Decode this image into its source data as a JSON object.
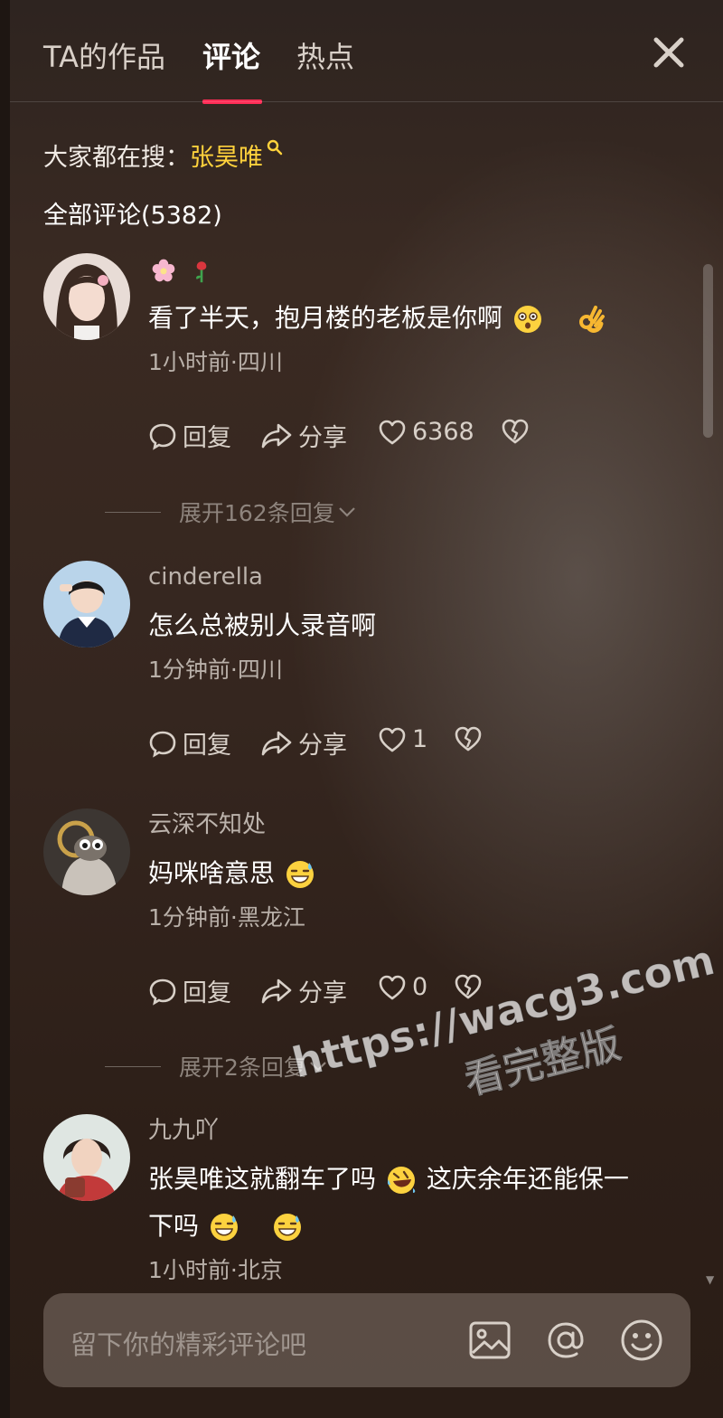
{
  "tabs": [
    {
      "label": "TA的作品",
      "active": false
    },
    {
      "label": "评论",
      "active": true
    },
    {
      "label": "热点",
      "active": false
    }
  ],
  "hot_search": {
    "prefix": "大家都在搜：",
    "term": "张昊唯"
  },
  "comments_header": "全部评论(5382)",
  "actions": {
    "reply": "回复",
    "share": "分享"
  },
  "comments": [
    {
      "username": "",
      "username_emojis": [
        "flower-emoji",
        "rose-emoji"
      ],
      "text": "看了半天，抱月楼的老板是你啊",
      "text_emojis": [
        "astonished-face-emoji",
        "ok-hand-emoji"
      ],
      "meta": "1小时前·四川",
      "likes": "6368",
      "expand": "展开162条回复"
    },
    {
      "username": "cinderella",
      "text": "怎么总被别人录音啊",
      "meta": "1分钟前·四川",
      "likes": "1",
      "expand": ""
    },
    {
      "username": "云深不知处",
      "text": "妈咪啥意思",
      "text_emojis": [
        "grinning-sweat-emoji"
      ],
      "meta": "1分钟前·黑龙江",
      "likes": "0",
      "expand": "展开2条回复"
    },
    {
      "username": "九九吖",
      "text_part1": "张昊唯这就翻车了吗",
      "text_part2": "这庆余年还能保一",
      "text_part3": "下吗",
      "text_emojis": [
        "rolling-laugh-emoji",
        "grinning-sweat-emoji",
        "grinning-sweat-emoji"
      ],
      "meta": "1小时前·北京"
    }
  ],
  "watermark": {
    "url": "https://wacg3.com",
    "sub": "看完整版"
  },
  "input": {
    "placeholder": "留下你的精彩评论吧"
  },
  "colors": {
    "accent": "#fe2c55",
    "hot_term": "#ffd23c"
  }
}
